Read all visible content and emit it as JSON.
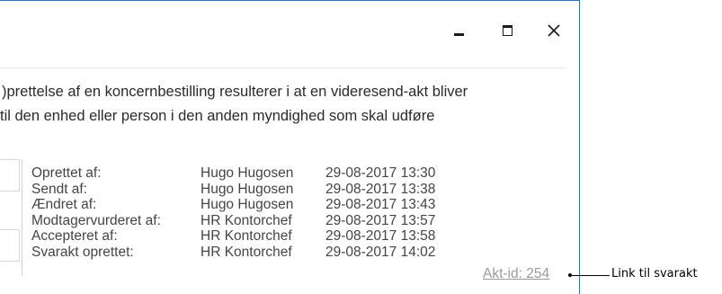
{
  "window": {
    "controls": {
      "minimize_icon": "minimize-icon",
      "maximize_icon": "maximize-icon",
      "close_icon": "close-icon"
    }
  },
  "description": {
    "line1": ")prettelse af en koncernbestilling resulterer i at en videresend-akt bliver",
    "line2": "til den enhed eller person i den anden myndighed som skal udføre"
  },
  "history": [
    {
      "label": "Oprettet af:",
      "person": "Hugo Hugosen",
      "datetime": "29-08-2017 13:30"
    },
    {
      "label": "Sendt af:",
      "person": "Hugo Hugosen",
      "datetime": "29-08-2017 13:38"
    },
    {
      "label": "Ændret af:",
      "person": "Hugo Hugosen",
      "datetime": "29-08-2017 13:43"
    },
    {
      "label": "Modtagervurderet af:",
      "person": "HR Kontorchef",
      "datetime": "29-08-2017 13:57"
    },
    {
      "label": "Accepteret af:",
      "person": "HR Kontorchef",
      "datetime": "29-08-2017 13:58"
    },
    {
      "label": "Svarakt oprettet:",
      "person": "HR Kontorchef",
      "datetime": "29-08-2017 14:02"
    }
  ],
  "akt_link": "Akt-id: 254",
  "callout": "Link til svarakt"
}
